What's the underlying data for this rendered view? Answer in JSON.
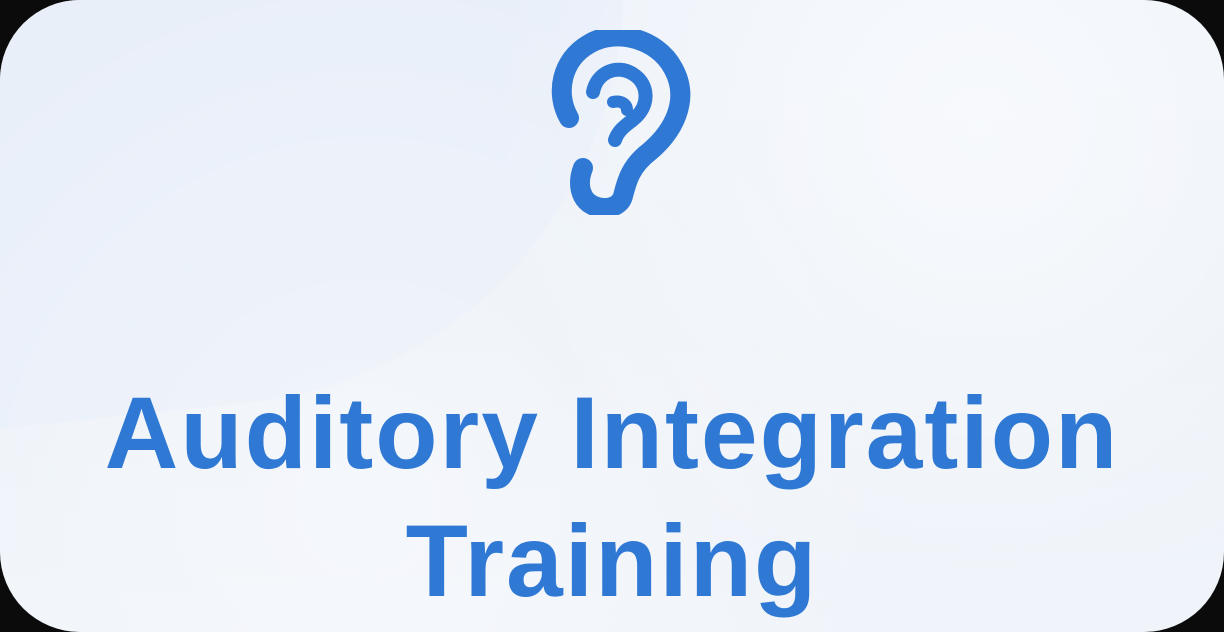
{
  "title": {
    "line1": "Auditory Integration",
    "line2": "Training"
  },
  "icon": {
    "name": "ear-icon",
    "color": "#2f79d4"
  }
}
